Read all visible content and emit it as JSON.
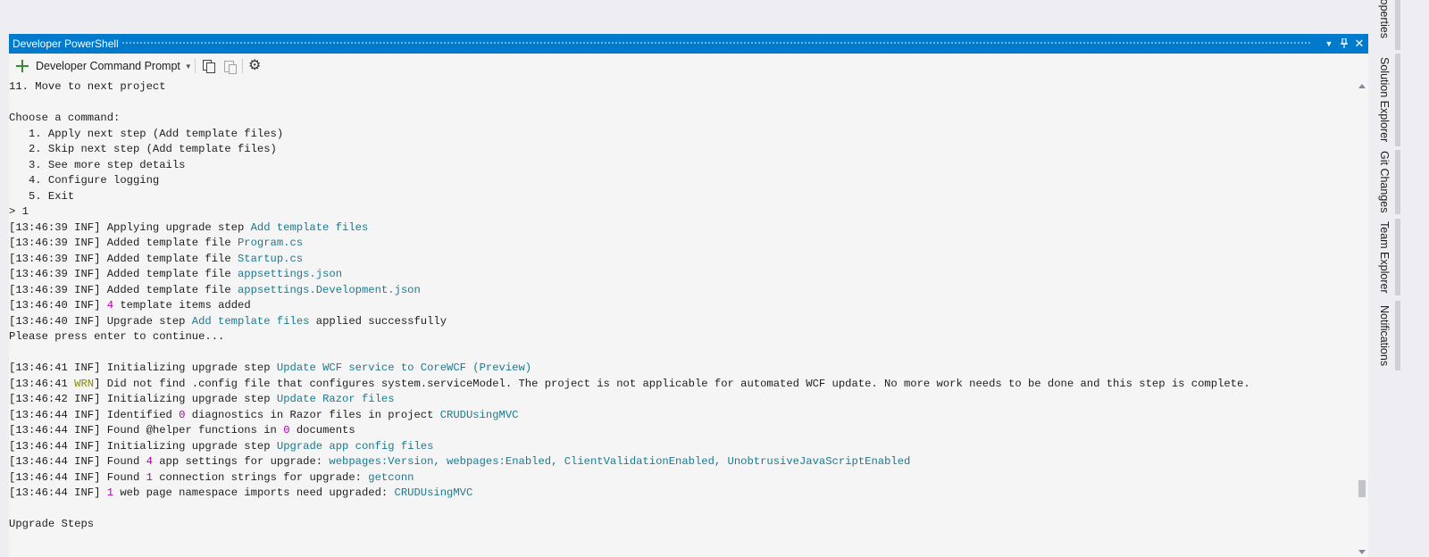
{
  "window": {
    "title": "Developer PowerShell"
  },
  "titlebar_icons": [
    "dropdown-icon",
    "pin-icon",
    "close-icon"
  ],
  "toolbar": {
    "new_terminal_label": "Developer Command Prompt"
  },
  "side_tabs": [
    "Properties",
    "Solution Explorer",
    "Git Changes",
    "Team Explorer",
    "Notifications"
  ],
  "colors": {
    "accent": "#007acc",
    "link": "#1b7a8f",
    "number": "#b000b0",
    "warn": "#8a8a00"
  },
  "terminal": {
    "lines": [
      [
        {
          "t": "11. Move to next project"
        }
      ],
      [
        {
          "t": ""
        }
      ],
      [
        {
          "t": "Choose a command:"
        }
      ],
      [
        {
          "t": "   1. Apply next step (Add template files)"
        }
      ],
      [
        {
          "t": "   2. Skip next step (Add template files)"
        }
      ],
      [
        {
          "t": "   3. See more step details"
        }
      ],
      [
        {
          "t": "   4. Configure logging"
        }
      ],
      [
        {
          "t": "   5. Exit"
        }
      ],
      [
        {
          "t": "> 1"
        }
      ],
      [
        {
          "t": "[13:46:39 INF] Applying upgrade step "
        },
        {
          "t": "Add template files",
          "c": "c-cyan"
        }
      ],
      [
        {
          "t": "[13:46:39 INF] Added template file "
        },
        {
          "t": "Program.cs",
          "c": "c-cyan"
        }
      ],
      [
        {
          "t": "[13:46:39 INF] Added template file "
        },
        {
          "t": "Startup.cs",
          "c": "c-cyan"
        }
      ],
      [
        {
          "t": "[13:46:39 INF] Added template file "
        },
        {
          "t": "appsettings.json",
          "c": "c-cyan"
        }
      ],
      [
        {
          "t": "[13:46:39 INF] Added template file "
        },
        {
          "t": "appsettings.Development.json",
          "c": "c-cyan"
        }
      ],
      [
        {
          "t": "[13:46:40 INF] "
        },
        {
          "t": "4",
          "c": "c-mag"
        },
        {
          "t": " template items added"
        }
      ],
      [
        {
          "t": "[13:46:40 INF] Upgrade step "
        },
        {
          "t": "Add template files",
          "c": "c-cyan"
        },
        {
          "t": " applied successfully"
        }
      ],
      [
        {
          "t": "Please press enter to continue..."
        }
      ],
      [
        {
          "t": ""
        }
      ],
      [
        {
          "t": "[13:46:41 INF] Initializing upgrade step "
        },
        {
          "t": "Update WCF service to CoreWCF (Preview)",
          "c": "c-cyan"
        }
      ],
      [
        {
          "t": "[13:46:41 "
        },
        {
          "t": "WRN",
          "c": "c-yel"
        },
        {
          "t": "] Did not find .config file that configures system.serviceModel. The project is not applicable for automated WCF update. No more work needs to be done and this step is complete."
        }
      ],
      [
        {
          "t": "[13:46:42 INF] Initializing upgrade step "
        },
        {
          "t": "Update Razor files",
          "c": "c-cyan"
        }
      ],
      [
        {
          "t": "[13:46:44 INF] Identified "
        },
        {
          "t": "0",
          "c": "c-mag"
        },
        {
          "t": " diagnostics in Razor files in project "
        },
        {
          "t": "CRUDUsingMVC",
          "c": "c-cyan"
        }
      ],
      [
        {
          "t": "[13:46:44 INF] Found @helper functions in "
        },
        {
          "t": "0",
          "c": "c-mag"
        },
        {
          "t": " documents"
        }
      ],
      [
        {
          "t": "[13:46:44 INF] Initializing upgrade step "
        },
        {
          "t": "Upgrade app config files",
          "c": "c-cyan"
        }
      ],
      [
        {
          "t": "[13:46:44 INF] Found "
        },
        {
          "t": "4",
          "c": "c-mag"
        },
        {
          "t": " app settings for upgrade: "
        },
        {
          "t": "webpages:Version, webpages:Enabled, ClientValidationEnabled, UnobtrusiveJavaScriptEnabled",
          "c": "c-cyan"
        }
      ],
      [
        {
          "t": "[13:46:44 INF] Found "
        },
        {
          "t": "1",
          "c": "c-mag"
        },
        {
          "t": " connection strings for upgrade: "
        },
        {
          "t": "getconn",
          "c": "c-cyan"
        }
      ],
      [
        {
          "t": "[13:46:44 INF] "
        },
        {
          "t": "1",
          "c": "c-mag"
        },
        {
          "t": " web page namespace imports need upgraded: "
        },
        {
          "t": "CRUDUsingMVC",
          "c": "c-cyan"
        }
      ],
      [
        {
          "t": ""
        }
      ],
      [
        {
          "t": "Upgrade Steps"
        }
      ]
    ]
  }
}
